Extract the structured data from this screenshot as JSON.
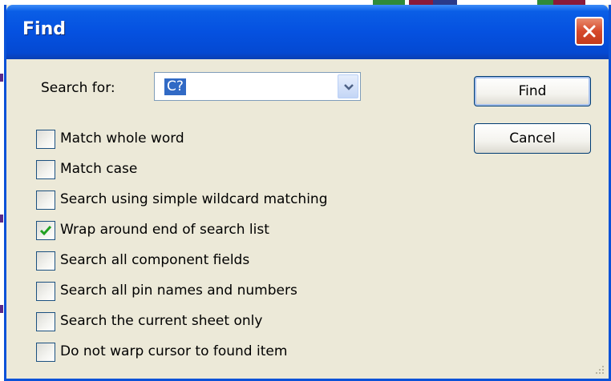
{
  "dialog": {
    "title": "Find",
    "search_label": "Search for:",
    "search_value": "C?",
    "buttons": {
      "find": "Find",
      "cancel": "Cancel"
    },
    "options": [
      {
        "label": "Match whole word",
        "checked": false
      },
      {
        "label": "Match case",
        "checked": false
      },
      {
        "label": "Search using simple wildcard matching",
        "checked": false
      },
      {
        "label": "Wrap around end of search list",
        "checked": true
      },
      {
        "label": "Search all component fields",
        "checked": false
      },
      {
        "label": "Search all pin names and numbers",
        "checked": false
      },
      {
        "label": "Search the current sheet only",
        "checked": false
      },
      {
        "label": "Do not warp cursor to found item",
        "checked": false
      }
    ]
  },
  "icons": {
    "close": "close-icon",
    "dropdown": "chevron-down-icon",
    "check": "checkmark-icon",
    "grip": "resize-grip-icon"
  },
  "colors": {
    "titlebar": "#0551e0",
    "dialog_bg": "#ece9d8",
    "close_button": "#d6492b",
    "selection": "#316ac5",
    "checkmark": "#21a121"
  }
}
